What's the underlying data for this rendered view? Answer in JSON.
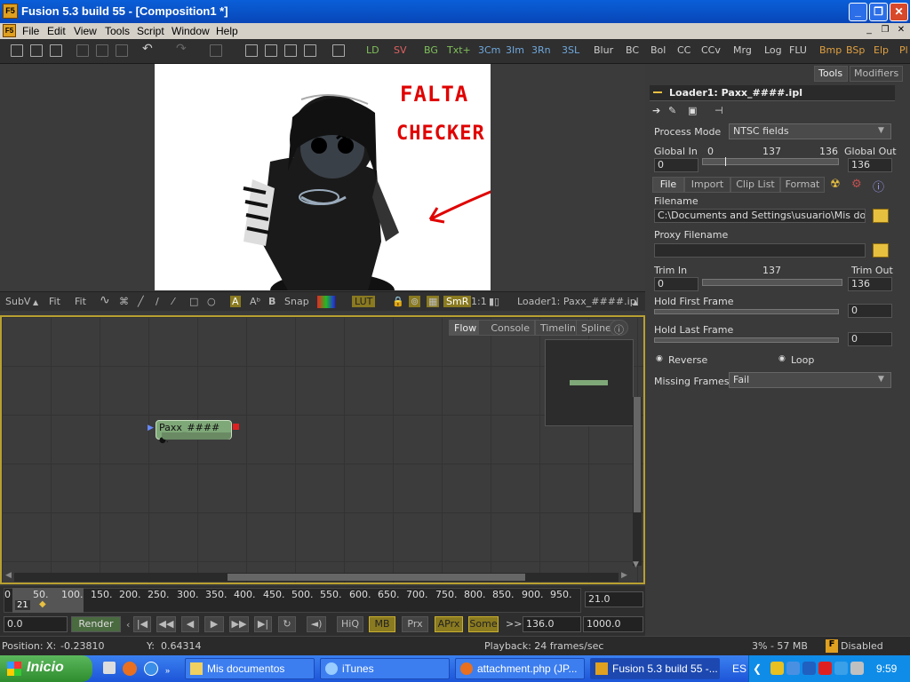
{
  "window": {
    "title": "Fusion 5.3 build 55 - [Composition1 *]",
    "app_icon": "F5"
  },
  "menu": [
    "File",
    "Edit",
    "View",
    "Tools",
    "Script",
    "Window",
    "Help"
  ],
  "toolbar": {
    "tools": [
      "LD",
      "SV",
      "BG",
      "Txt+",
      "3Cm",
      "3Im",
      "3Rn",
      "3SL",
      "Blur",
      "BC",
      "Bol",
      "CC",
      "CCv",
      "Mrg",
      "Log",
      "FLU",
      "Bmp",
      "BSp",
      "Elp",
      "Pl"
    ]
  },
  "viewer": {
    "annotation_line1": "FALTA",
    "annotation_line2": "CHECKER"
  },
  "viewbar": {
    "subv": "SubV",
    "fit1": "Fit",
    "fit2": "Fit",
    "snap": "Snap",
    "lut": "LUT",
    "smr": "SmR",
    "ratio": "1:1",
    "loader": "Loader1: Paxx_####.ipl"
  },
  "flow": {
    "tabs": [
      "Flow",
      "Console",
      "Timeline",
      "Spline"
    ],
    "node_label": "Paxx_####"
  },
  "timeline": {
    "ticks": [
      "0",
      "50.",
      "100.",
      "150.",
      "200.",
      "250.",
      "300.",
      "350.",
      "400.",
      "450.",
      "500.",
      "550.",
      "600.",
      "650.",
      "700.",
      "750.",
      "800.",
      "850.",
      "900.",
      "950."
    ],
    "current_marker": "21",
    "current_value": "21.0"
  },
  "transport": {
    "start": "0.0",
    "render": "Render",
    "hiq": "HiQ",
    "mb": "MB",
    "prx": "Prx",
    "aprx": "APrx",
    "some": "Some",
    "arrows": ">>",
    "end_render": "136.0",
    "end_global": "1000.0"
  },
  "panel": {
    "tabs": [
      "Tools",
      "Modifiers"
    ],
    "header": "Loader1: Paxx_####.ipl",
    "process_mode_label": "Process Mode",
    "process_mode_value": "NTSC fields",
    "global_in_label": "Global In",
    "global_out_label": "Global Out",
    "global_slider_min": "0",
    "global_slider_mid": "137",
    "global_slider_max": "136",
    "global_in_value": "0",
    "global_out_value": "136",
    "subtabs": [
      "File",
      "Import",
      "Clip List",
      "Format"
    ],
    "filename_label": "Filename",
    "filename_value": "C:\\Documents and Settings\\usuario\\Mis docume",
    "proxy_label": "Proxy Filename",
    "proxy_value": "",
    "trim_in_label": "Trim In",
    "trim_mid": "137",
    "trim_out_label": "Trim Out",
    "trim_in_value": "0",
    "trim_out_value": "136",
    "hold_first_label": "Hold First Frame",
    "hold_first_value": "0",
    "hold_last_label": "Hold Last Frame",
    "hold_last_value": "0",
    "reverse_label": "Reverse",
    "loop_label": "Loop",
    "missing_label": "Missing Frames",
    "missing_value": "Fail"
  },
  "status": {
    "position_label": "Position:",
    "x_label": "X:",
    "x_value": "-0.23810",
    "y_label": "Y:",
    "y_value": "0.64314",
    "playback": "Playback: 24 frames/sec",
    "memory": "3% - 57 MB",
    "disabled": "Disabled"
  },
  "taskbar": {
    "start": "Inicio",
    "tasks": [
      "Mis documentos",
      "iTunes",
      "attachment.php (JP...",
      "Fusion 5.3 build 55 -..."
    ],
    "lang": "ES",
    "clock": "9:59"
  }
}
